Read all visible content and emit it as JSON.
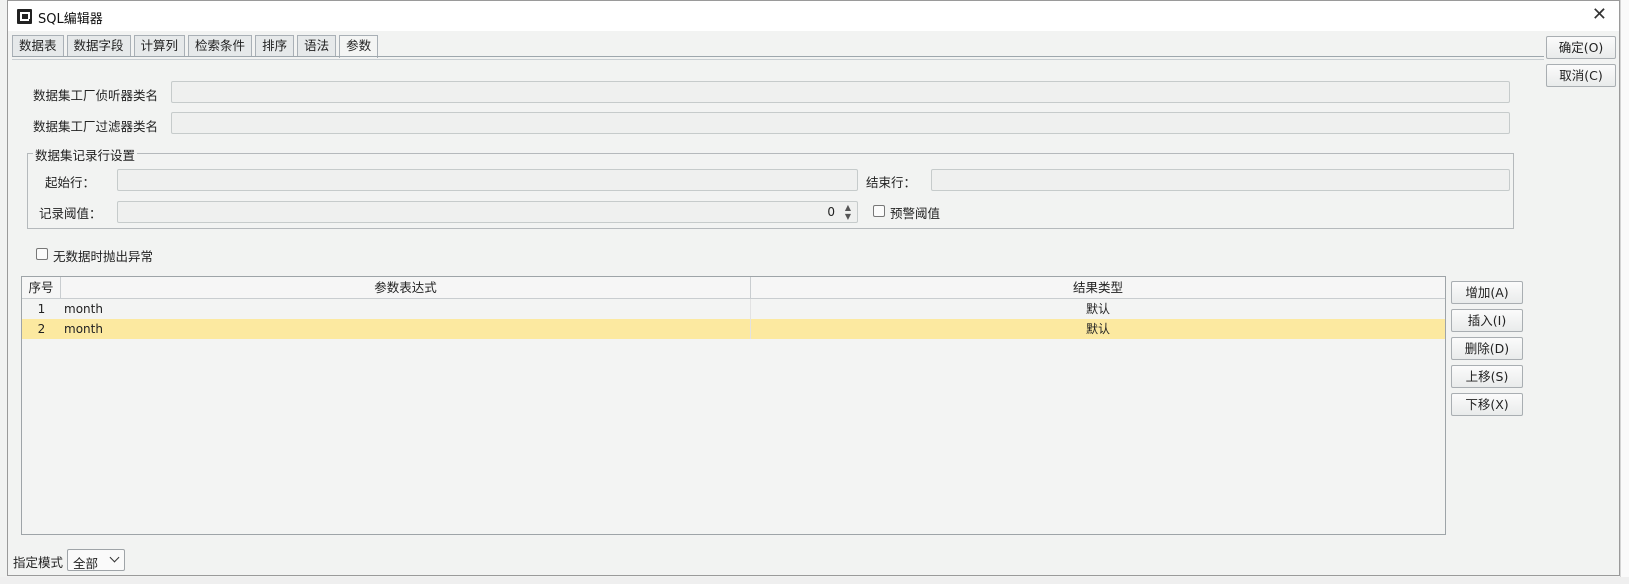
{
  "window": {
    "title": "SQL编辑器"
  },
  "tabs": [
    "数据表",
    "数据字段",
    "计算列",
    "检索条件",
    "排序",
    "语法",
    "参数"
  ],
  "active_tab": "参数",
  "dialog_buttons": {
    "ok": "确定(O)",
    "cancel": "取消(C)"
  },
  "form": {
    "listener_label": "数据集工厂侦听器类名",
    "listener_value": "",
    "filter_label": "数据集工厂过滤器类名",
    "filter_value": "",
    "record_group": {
      "title": "数据集记录行设置",
      "start_row_label": "起始行：",
      "start_row_value": "",
      "end_row_label": "结束行：",
      "end_row_value": "",
      "threshold_label": "记录阈值：",
      "threshold_value": "0",
      "warn_threshold_label": "预警阈值",
      "warn_threshold_checked": false
    },
    "no_data_exception_label": "无数据时抛出异常",
    "no_data_exception_checked": false
  },
  "params_table": {
    "columns": [
      "序号",
      "参数表达式",
      "结果类型"
    ],
    "rows": [
      {
        "index": "1",
        "expression": "month",
        "type": "默认",
        "selected": false
      },
      {
        "index": "2",
        "expression": "month",
        "type": "默认",
        "selected": true
      }
    ]
  },
  "table_buttons": {
    "add": "增加(A)",
    "insert": "插入(I)",
    "delete": "删除(D)",
    "move_up": "上移(S)",
    "move_down": "下移(X)"
  },
  "mode": {
    "label": "指定模式",
    "value": "全部"
  },
  "colors": {
    "selected_row": "#fce9a0",
    "background": "#f2f3f2"
  }
}
